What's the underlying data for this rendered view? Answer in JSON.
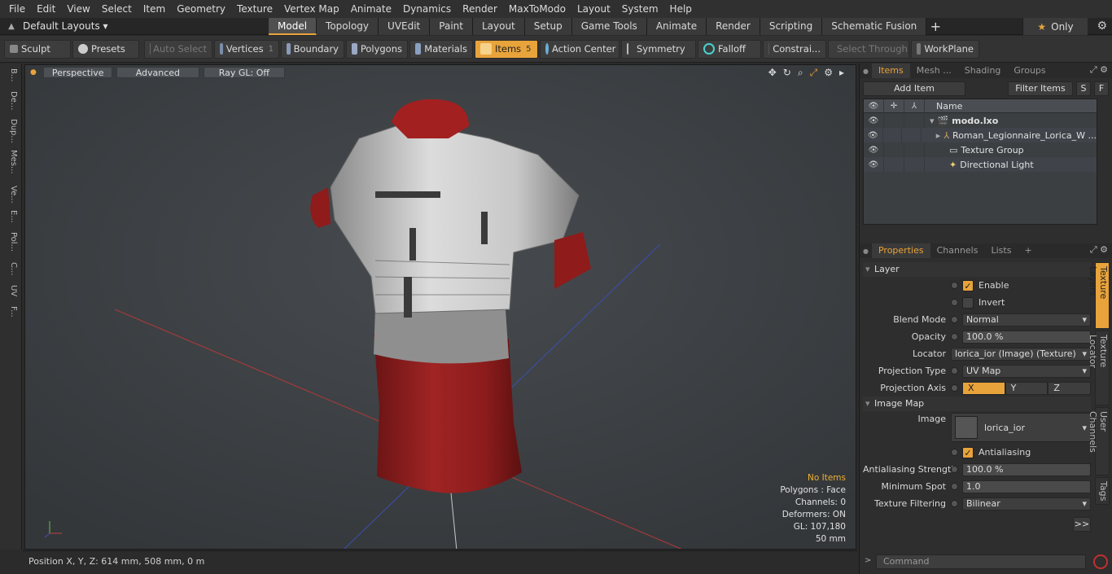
{
  "menu": [
    "File",
    "Edit",
    "View",
    "Select",
    "Item",
    "Geometry",
    "Texture",
    "Vertex Map",
    "Animate",
    "Dynamics",
    "Render",
    "MaxToModo",
    "Layout",
    "System",
    "Help"
  ],
  "layout_selector": "Default Layouts ▾",
  "layout_tabs": [
    "Model",
    "Topology",
    "UVEdit",
    "Paint",
    "Layout",
    "Setup",
    "Game Tools",
    "Animate",
    "Render",
    "Scripting",
    "Schematic Fusion"
  ],
  "only_label": "Only",
  "toolbar": {
    "sculpt": "Sculpt",
    "presets": "Presets",
    "auto_select": "Auto Select",
    "vertices": "Vertices",
    "vertices_count": "1",
    "boundary": "Boundary",
    "polygons": "Polygons",
    "materials": "Materials",
    "items": "Items",
    "items_count": "5",
    "action_center": "Action Center",
    "symmetry": "Symmetry",
    "falloff": "Falloff",
    "constraints": "Constrai...",
    "select_through": "Select Through",
    "workplane": "WorkPlane"
  },
  "left_tabs": [
    "B...",
    "De...",
    "Dup...",
    "Mes...",
    "Ve...",
    "E...",
    "Pol...",
    "C...",
    "UV",
    "F..."
  ],
  "viewport": {
    "perspective": "Perspective",
    "advanced": "Advanced",
    "raygl": "Ray GL: Off",
    "stats": {
      "no_items": "No Items",
      "polygons": "Polygons : Face",
      "channels": "Channels: 0",
      "deformers": "Deformers: ON",
      "gl": "GL: 107,180",
      "scale": "50 mm"
    }
  },
  "status": "Position X, Y, Z:   614 mm, 508 mm, 0 m",
  "items_panel": {
    "tabs": [
      "Items",
      "Mesh ...",
      "Shading",
      "Groups"
    ],
    "add_item": "Add Item",
    "filter_items": "Filter Items",
    "s": "S",
    "f": "F",
    "name_header": "Name",
    "tree": [
      "modo.lxo",
      "Roman_Legionnaire_Lorica_W ...",
      "Texture Group",
      "Directional Light"
    ]
  },
  "properties_panel": {
    "tabs": [
      "Properties",
      "Channels",
      "Lists"
    ],
    "layer_section": "Layer",
    "enable": "Enable",
    "invert": "Invert",
    "blend_mode_label": "Blend Mode",
    "blend_mode": "Normal",
    "opacity_label": "Opacity",
    "opacity": "100.0 %",
    "locator_label": "Locator",
    "locator": "lorica_ior (Image) (Texture)",
    "projection_type_label": "Projection Type",
    "projection_type": "UV Map",
    "projection_axis_label": "Projection Axis",
    "axes": [
      "X",
      "Y",
      "Z"
    ],
    "image_map_section": "Image Map",
    "image_label": "Image",
    "image": "lorica_ior",
    "antialiasing": "Antialiasing",
    "aa_strength_label": "Antialiasing Strength",
    "aa_strength": "100.0 %",
    "min_spot_label": "Minimum Spot",
    "min_spot": "1.0",
    "tex_filter_label": "Texture Filtering",
    "tex_filter": "Bilinear",
    "more": ">>",
    "side_tabs": [
      "Texture Layers",
      "Texture Locator",
      "User Channels",
      "Tags"
    ]
  },
  "command_placeholder": "Command",
  "colors": {
    "accent": "#e8a33a",
    "viewport_bg": "#3f4346",
    "armor_red": "#9a1e1e"
  }
}
